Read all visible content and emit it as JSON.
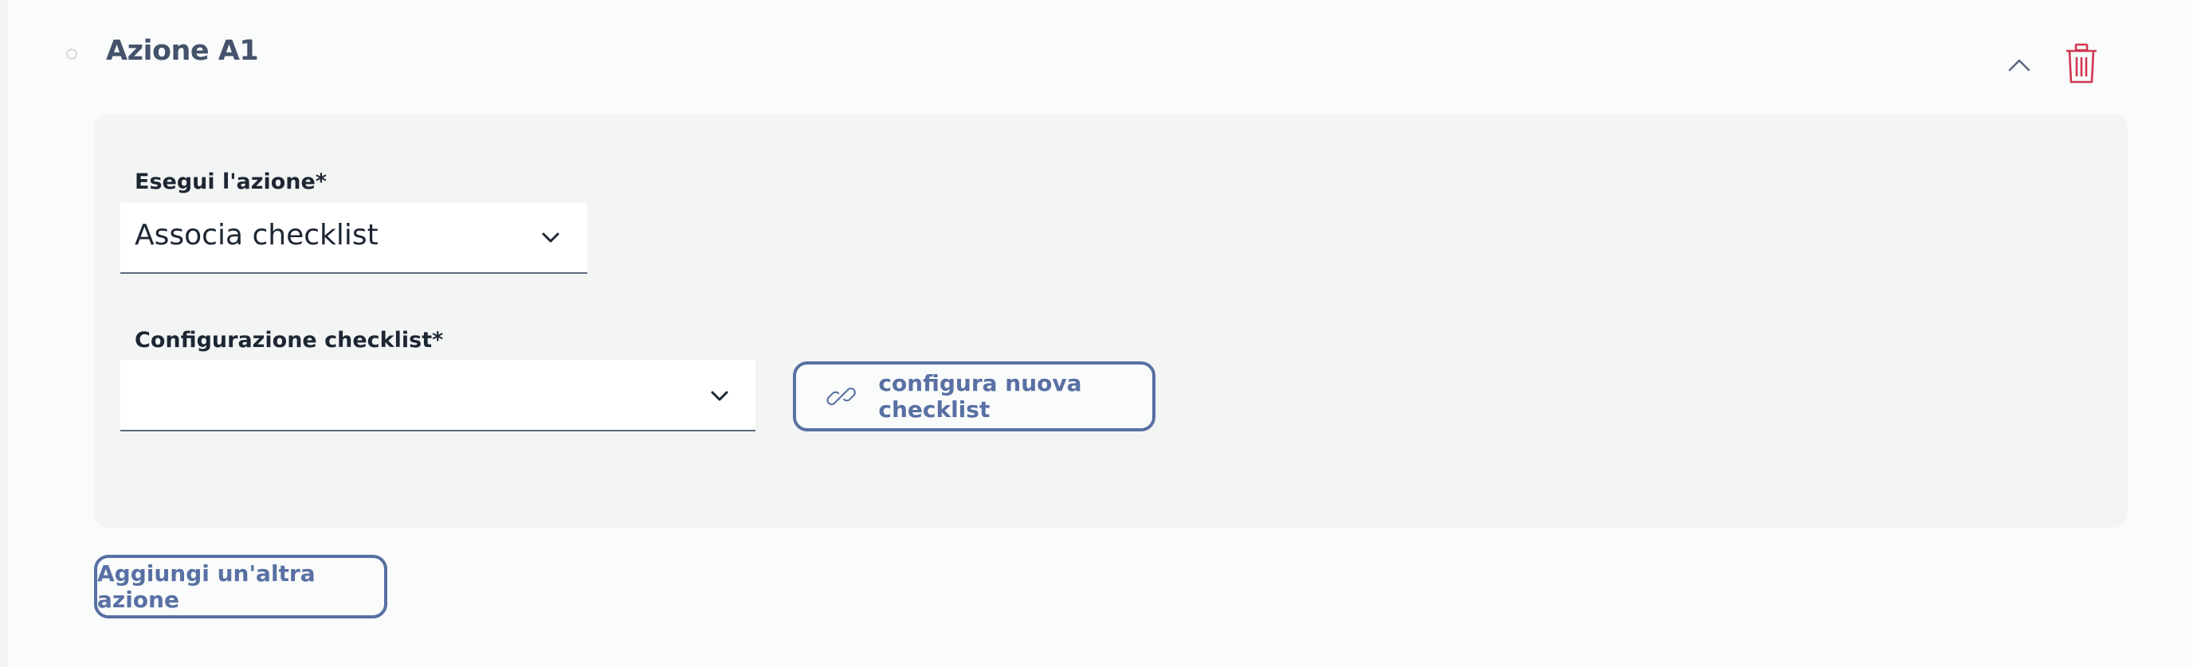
{
  "action": {
    "title": "Azione A1",
    "field_execute": {
      "label": "Esegui l'azione*",
      "value": "Associa checklist"
    },
    "field_config": {
      "label": "Configurazione checklist*",
      "value": ""
    },
    "configure_button_label": "configura nuova checklist"
  },
  "add_action_button_label": "Aggiungi un'altra azione",
  "colors": {
    "accent": "#5870a3",
    "title": "#44536b",
    "delete": "#d0364f",
    "panel": "#f3f5f5"
  },
  "icons": {
    "collapse": "chevron-up-icon",
    "delete": "trash-icon",
    "dropdown": "chevron-down-icon",
    "link": "link-icon"
  }
}
